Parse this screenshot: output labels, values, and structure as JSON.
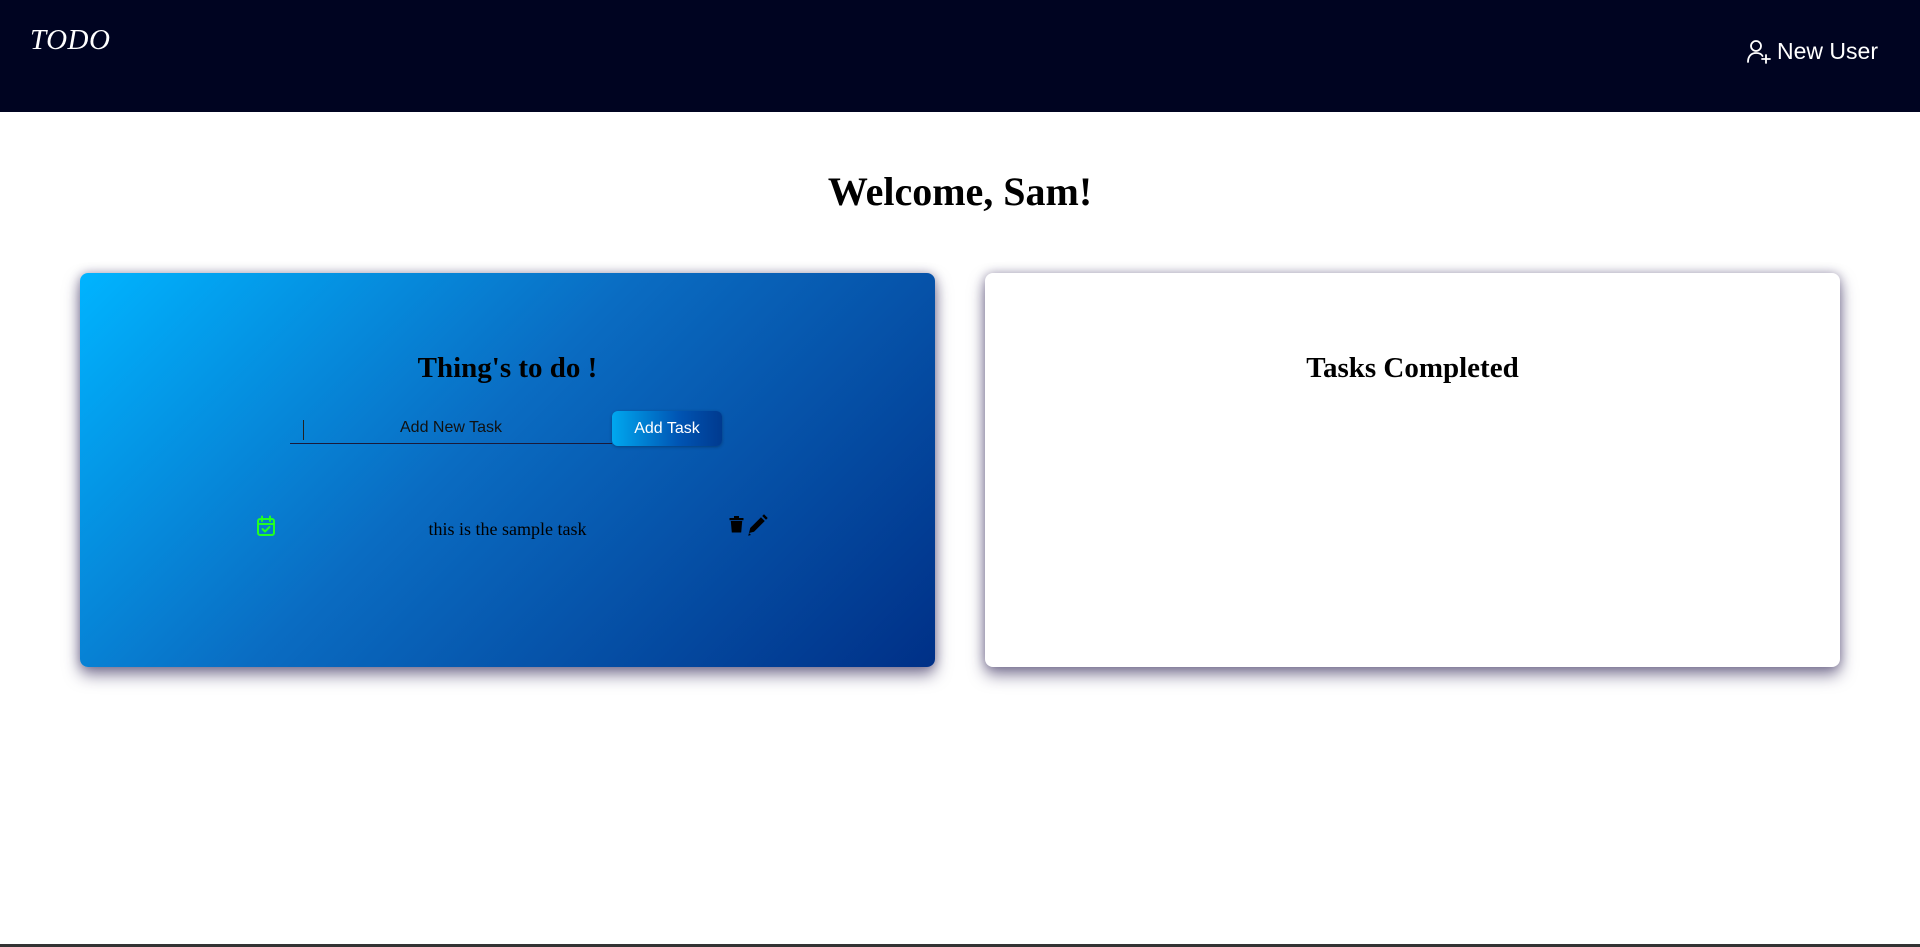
{
  "header": {
    "brand": "TODO",
    "new_user_label": "New User",
    "new_user_icon": "user-plus-icon",
    "background": "#000421"
  },
  "main": {
    "welcome": "Welcome, Sam!"
  },
  "todo_panel": {
    "title": "Thing's to do !",
    "input_placeholder": "Add New Task",
    "input_value": "",
    "add_button_label": "Add Task",
    "tasks": [
      {
        "text": "this is the sample task",
        "complete_icon": "calendar-check-icon",
        "delete_icon": "trash-icon",
        "edit_icon": "pencil-icon"
      }
    ],
    "accent_start": "#00b4ff",
    "accent_end": "#003087"
  },
  "completed_panel": {
    "title": "Tasks Completed"
  }
}
